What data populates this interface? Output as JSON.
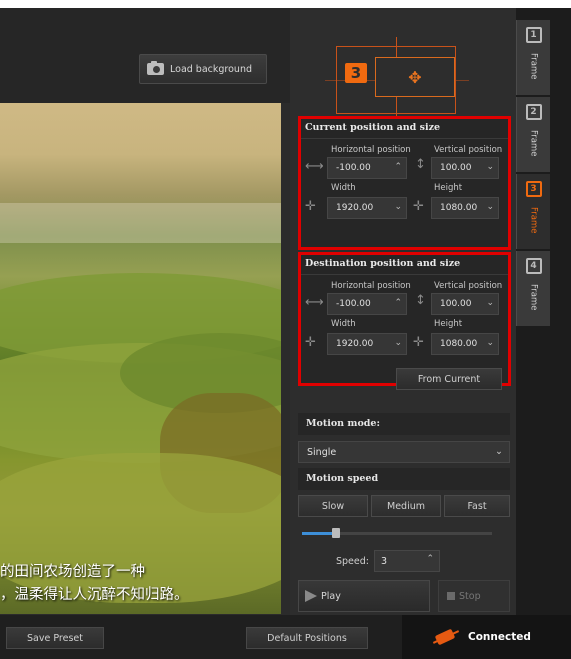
{
  "toolbar": {
    "load_background": "Load background"
  },
  "preview": {
    "subtitle_line1": "的田间农场创造了一种",
    "subtitle_line2": "，温柔得让人沉醉不知归路。"
  },
  "current": {
    "title": "Current position and size",
    "h_label": "Horizontal position",
    "h_value": "-100.00",
    "v_label": "Vertical position",
    "v_value": "100.00",
    "w_label": "Width",
    "w_value": "1920.00",
    "ht_label": "Height",
    "ht_value": "1080.00"
  },
  "destination": {
    "title": "Destination position and size",
    "h_label": "Horizontal position",
    "h_value": "-100.00",
    "v_label": "Vertical position",
    "v_value": "100.00",
    "w_label": "Width",
    "w_value": "1920.00",
    "ht_label": "Height",
    "ht_value": "1080.00"
  },
  "from_current": "From Current",
  "motion": {
    "mode_title": "Motion mode:",
    "mode_value": "Single",
    "speed_title": "Motion speed",
    "slow": "Slow",
    "medium": "Medium",
    "fast": "Fast",
    "speed_label": "Speed:",
    "speed_value": "3",
    "slider_fraction": 0.18,
    "play": "Play",
    "stop": "Stop"
  },
  "tabs": [
    {
      "num": "1",
      "label": "Frame"
    },
    {
      "num": "2",
      "label": "Frame"
    },
    {
      "num": "3",
      "label": "Frame"
    },
    {
      "num": "4",
      "label": "Frame"
    }
  ],
  "bottom": {
    "save_preset": "Save Preset",
    "default_positions": "Default Positions",
    "status": "Connected"
  },
  "colors": {
    "accent": "#f06a10",
    "highlight_border": "#e00000",
    "slider": "#3d8fd8"
  }
}
